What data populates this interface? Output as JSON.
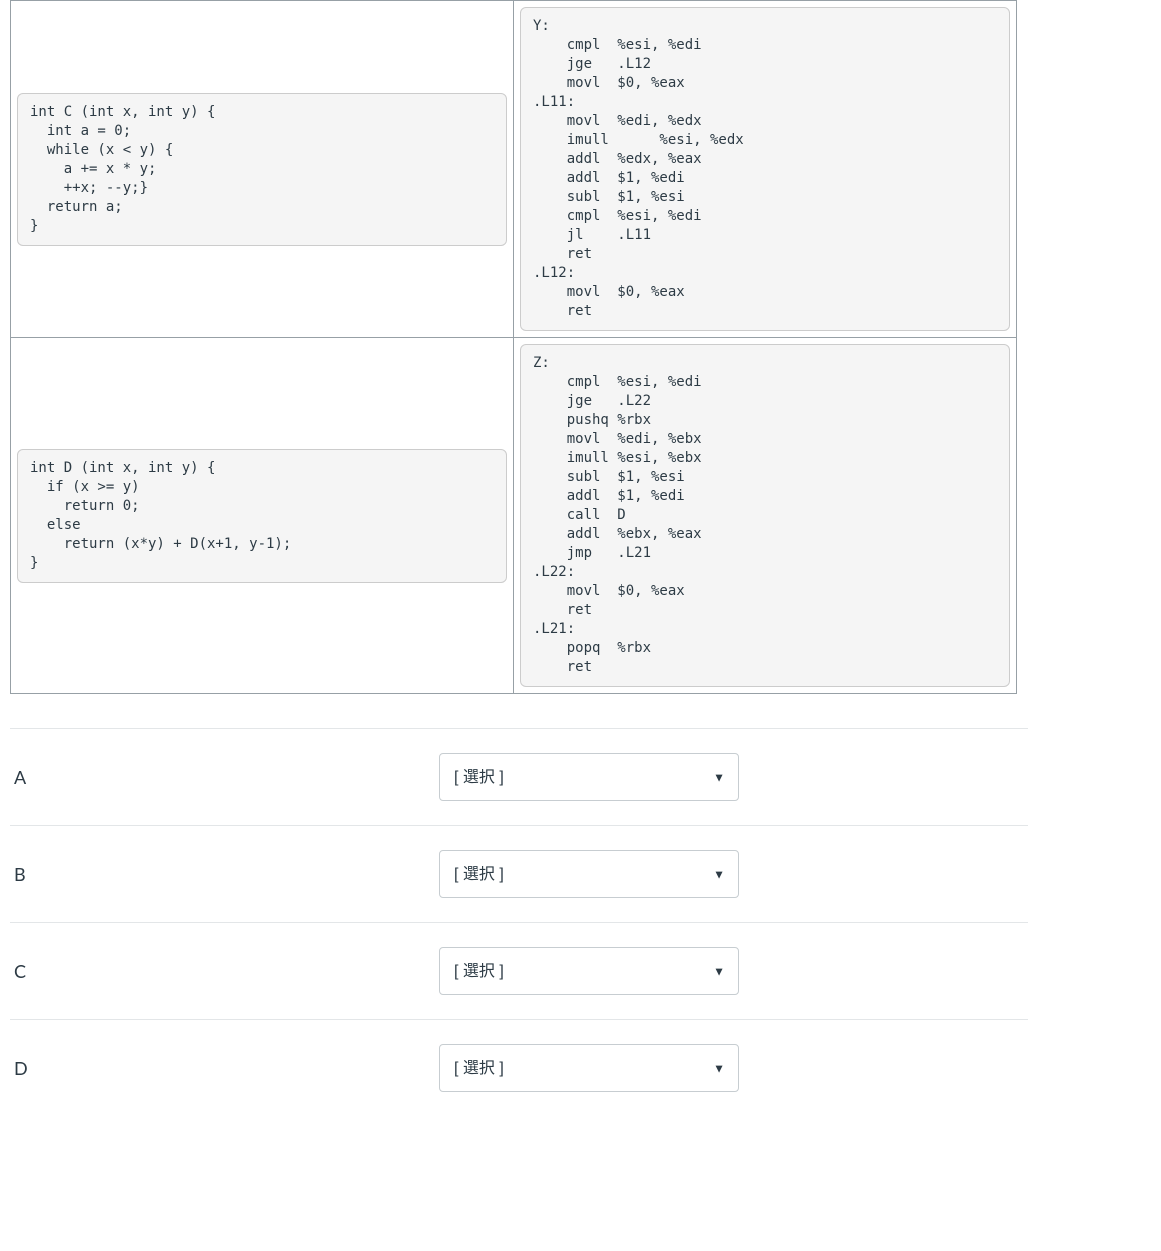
{
  "table": {
    "rows": [
      {
        "c_code": "int C (int x, int y) {\n  int a = 0;\n  while (x < y) {\n    a += x * y;\n    ++x; --y;}\n  return a;\n}",
        "asm_code": "Y:\n    cmpl  %esi, %edi\n    jge   .L12\n    movl  $0, %eax\n.L11:\n    movl  %edi, %edx\n    imull      %esi, %edx\n    addl  %edx, %eax\n    addl  $1, %edi\n    subl  $1, %esi\n    cmpl  %esi, %edi\n    jl    .L11\n    ret\n.L12:\n    movl  $0, %eax\n    ret"
      },
      {
        "c_code": "int D (int x, int y) {\n  if (x >= y)\n    return 0;\n  else\n    return (x*y) + D(x+1, y-1);\n}",
        "asm_code": "Z:\n    cmpl  %esi, %edi\n    jge   .L22\n    pushq %rbx\n    movl  %edi, %ebx\n    imull %esi, %ebx\n    subl  $1, %esi\n    addl  $1, %edi\n    call  D\n    addl  %ebx, %eax\n    jmp   .L21\n.L22:\n    movl  $0, %eax\n    ret\n.L21:\n    popq  %rbx\n    ret"
      }
    ]
  },
  "answers": {
    "placeholder": "[ 選択 ]",
    "items": [
      {
        "label": "A"
      },
      {
        "label": "B"
      },
      {
        "label": "C"
      },
      {
        "label": "D"
      }
    ]
  }
}
